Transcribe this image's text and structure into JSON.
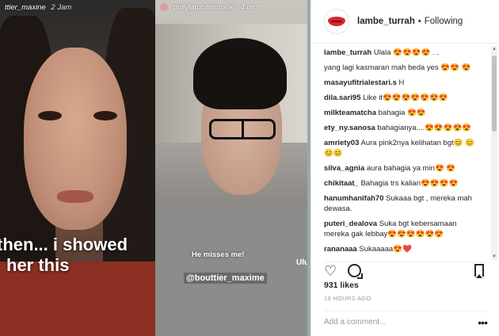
{
  "media": {
    "left_story": {
      "user": "ttier_maxine",
      "time": "2 Jam",
      "caption_line1": "then... i showed",
      "caption_line2": "her this"
    },
    "right_story": {
      "user": "prillylatuconsina96",
      "time": "4 mnt",
      "caption_misses": "He misses me!",
      "caption_handle": "@bouttier_maxime",
      "caption_extra": "Ulu u"
    }
  },
  "header": {
    "username": "lambe_turrah",
    "separator": "•",
    "follow_status": "Following"
  },
  "comments": [
    {
      "user": "lambe_turrah",
      "text": "Ulala 😍😍😍😍 . ."
    },
    {
      "user": "",
      "text": "yang lagi kasmaran mah beda yes 😍😍 😍"
    },
    {
      "user": "masayufitrialestari.s",
      "text": "H"
    },
    {
      "user": "dila.sari95",
      "text": "Like it😍😍😍😍😍😍😍"
    },
    {
      "user": "milkteamatcha",
      "text": "bahagia 😍😍"
    },
    {
      "user": "ety_ny.sanosa",
      "text": "bahagianya....😍😍😍😍😍"
    },
    {
      "user": "amriety03",
      "text": "Aura pink2nya kelihatan bgt😊 😊😊😊"
    },
    {
      "user": "silva_agnia",
      "text": "aura bahagia ya min😍 😍"
    },
    {
      "user": "chikitaat_",
      "text": "Bahagia trs kalian😍😍😍😍"
    },
    {
      "user": "hanumhanifah70",
      "text": "Sukaaa bgt , mereka mah dewasa."
    },
    {
      "user": "puteri_dealova",
      "text": "Suka bgt kebersamaan mereka gak lebbay😍😍😍😍😍😍"
    },
    {
      "user": "rananaaa",
      "text": "Sukaaaaa😍❤️"
    }
  ],
  "actions": {
    "like_icon": "heart-icon",
    "comment_icon": "comment-icon",
    "save_icon": "bookmark-icon"
  },
  "likes": "931 likes",
  "time_ago": "19 HOURS AGO",
  "add_comment": {
    "placeholder": "Add a comment...",
    "more": "•••"
  },
  "colors": {
    "brand_lip": "#d8262c",
    "text": "#262626",
    "muted": "#999999"
  }
}
